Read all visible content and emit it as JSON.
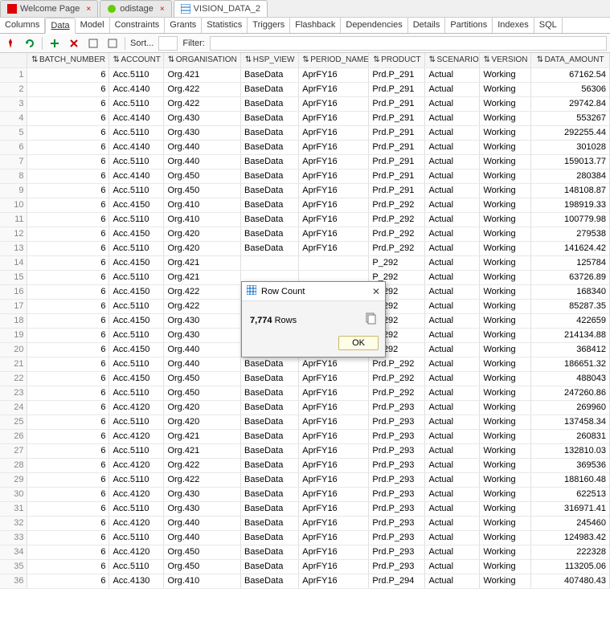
{
  "tabs": [
    {
      "label": "Welcome Page",
      "icon": "oracle-icon"
    },
    {
      "label": "odistage",
      "icon": "sql-icon"
    },
    {
      "label": "VISION_DATA_2",
      "icon": "table-icon",
      "active": true
    }
  ],
  "subtabs": [
    "Columns",
    "Data",
    "Model",
    "Constraints",
    "Grants",
    "Statistics",
    "Triggers",
    "Flashback",
    "Dependencies",
    "Details",
    "Partitions",
    "Indexes",
    "SQL"
  ],
  "active_subtab": "Data",
  "toolbar": {
    "sort_label": "Sort...",
    "sort_value": "",
    "filter_label": "Filter:",
    "filter_value": ""
  },
  "columns": [
    "BATCH_NUMBER",
    "ACCOUNT",
    "ORGANISATION",
    "HSP_VIEW",
    "PERIOD_NAME",
    "PRODUCT",
    "SCENARIO",
    "VERSION",
    "DATA_AMOUNT"
  ],
  "rows": [
    {
      "n": 1,
      "batch": 6,
      "acct": "Acc.5110",
      "org": "Org.421",
      "hsp": "BaseData",
      "per": "AprFY16",
      "prd": "Prd.P_291",
      "scen": "Actual",
      "ver": "Working",
      "amt": "67162.54"
    },
    {
      "n": 2,
      "batch": 6,
      "acct": "Acc.4140",
      "org": "Org.422",
      "hsp": "BaseData",
      "per": "AprFY16",
      "prd": "Prd.P_291",
      "scen": "Actual",
      "ver": "Working",
      "amt": "56306"
    },
    {
      "n": 3,
      "batch": 6,
      "acct": "Acc.5110",
      "org": "Org.422",
      "hsp": "BaseData",
      "per": "AprFY16",
      "prd": "Prd.P_291",
      "scen": "Actual",
      "ver": "Working",
      "amt": "29742.84"
    },
    {
      "n": 4,
      "batch": 6,
      "acct": "Acc.4140",
      "org": "Org.430",
      "hsp": "BaseData",
      "per": "AprFY16",
      "prd": "Prd.P_291",
      "scen": "Actual",
      "ver": "Working",
      "amt": "553267"
    },
    {
      "n": 5,
      "batch": 6,
      "acct": "Acc.5110",
      "org": "Org.430",
      "hsp": "BaseData",
      "per": "AprFY16",
      "prd": "Prd.P_291",
      "scen": "Actual",
      "ver": "Working",
      "amt": "292255.44"
    },
    {
      "n": 6,
      "batch": 6,
      "acct": "Acc.4140",
      "org": "Org.440",
      "hsp": "BaseData",
      "per": "AprFY16",
      "prd": "Prd.P_291",
      "scen": "Actual",
      "ver": "Working",
      "amt": "301028"
    },
    {
      "n": 7,
      "batch": 6,
      "acct": "Acc.5110",
      "org": "Org.440",
      "hsp": "BaseData",
      "per": "AprFY16",
      "prd": "Prd.P_291",
      "scen": "Actual",
      "ver": "Working",
      "amt": "159013.77"
    },
    {
      "n": 8,
      "batch": 6,
      "acct": "Acc.4140",
      "org": "Org.450",
      "hsp": "BaseData",
      "per": "AprFY16",
      "prd": "Prd.P_291",
      "scen": "Actual",
      "ver": "Working",
      "amt": "280384"
    },
    {
      "n": 9,
      "batch": 6,
      "acct": "Acc.5110",
      "org": "Org.450",
      "hsp": "BaseData",
      "per": "AprFY16",
      "prd": "Prd.P_291",
      "scen": "Actual",
      "ver": "Working",
      "amt": "148108.87"
    },
    {
      "n": 10,
      "batch": 6,
      "acct": "Acc.4150",
      "org": "Org.410",
      "hsp": "BaseData",
      "per": "AprFY16",
      "prd": "Prd.P_292",
      "scen": "Actual",
      "ver": "Working",
      "amt": "198919.33"
    },
    {
      "n": 11,
      "batch": 6,
      "acct": "Acc.5110",
      "org": "Org.410",
      "hsp": "BaseData",
      "per": "AprFY16",
      "prd": "Prd.P_292",
      "scen": "Actual",
      "ver": "Working",
      "amt": "100779.98"
    },
    {
      "n": 12,
      "batch": 6,
      "acct": "Acc.4150",
      "org": "Org.420",
      "hsp": "BaseData",
      "per": "AprFY16",
      "prd": "Prd.P_292",
      "scen": "Actual",
      "ver": "Working",
      "amt": "279538"
    },
    {
      "n": 13,
      "batch": 6,
      "acct": "Acc.5110",
      "org": "Org.420",
      "hsp": "BaseData",
      "per": "AprFY16",
      "prd": "Prd.P_292",
      "scen": "Actual",
      "ver": "Working",
      "amt": "141624.42"
    },
    {
      "n": 14,
      "batch": 6,
      "acct": "Acc.4150",
      "org": "Org.421",
      "hsp": "",
      "per": "",
      "prd": "P_292",
      "scen": "Actual",
      "ver": "Working",
      "amt": "125784"
    },
    {
      "n": 15,
      "batch": 6,
      "acct": "Acc.5110",
      "org": "Org.421",
      "hsp": "",
      "per": "",
      "prd": "P_292",
      "scen": "Actual",
      "ver": "Working",
      "amt": "63726.89"
    },
    {
      "n": 16,
      "batch": 6,
      "acct": "Acc.4150",
      "org": "Org.422",
      "hsp": "",
      "per": "",
      "prd": "P_292",
      "scen": "Actual",
      "ver": "Working",
      "amt": "168340"
    },
    {
      "n": 17,
      "batch": 6,
      "acct": "Acc.5110",
      "org": "Org.422",
      "hsp": "",
      "per": "",
      "prd": "P_292",
      "scen": "Actual",
      "ver": "Working",
      "amt": "85287.35"
    },
    {
      "n": 18,
      "batch": 6,
      "acct": "Acc.4150",
      "org": "Org.430",
      "hsp": "",
      "per": "",
      "prd": "P_292",
      "scen": "Actual",
      "ver": "Working",
      "amt": "422659"
    },
    {
      "n": 19,
      "batch": 6,
      "acct": "Acc.5110",
      "org": "Org.430",
      "hsp": "",
      "per": "",
      "prd": "P_292",
      "scen": "Actual",
      "ver": "Working",
      "amt": "214134.88"
    },
    {
      "n": 20,
      "batch": 6,
      "acct": "Acc.4150",
      "org": "Org.440",
      "hsp": "",
      "per": "",
      "prd": "P_292",
      "scen": "Actual",
      "ver": "Working",
      "amt": "368412"
    },
    {
      "n": 21,
      "batch": 6,
      "acct": "Acc.5110",
      "org": "Org.440",
      "hsp": "BaseData",
      "per": "AprFY16",
      "prd": "Prd.P_292",
      "scen": "Actual",
      "ver": "Working",
      "amt": "186651.32"
    },
    {
      "n": 22,
      "batch": 6,
      "acct": "Acc.4150",
      "org": "Org.450",
      "hsp": "BaseData",
      "per": "AprFY16",
      "prd": "Prd.P_292",
      "scen": "Actual",
      "ver": "Working",
      "amt": "488043"
    },
    {
      "n": 23,
      "batch": 6,
      "acct": "Acc.5110",
      "org": "Org.450",
      "hsp": "BaseData",
      "per": "AprFY16",
      "prd": "Prd.P_292",
      "scen": "Actual",
      "ver": "Working",
      "amt": "247260.86"
    },
    {
      "n": 24,
      "batch": 6,
      "acct": "Acc.4120",
      "org": "Org.420",
      "hsp": "BaseData",
      "per": "AprFY16",
      "prd": "Prd.P_293",
      "scen": "Actual",
      "ver": "Working",
      "amt": "269960"
    },
    {
      "n": 25,
      "batch": 6,
      "acct": "Acc.5110",
      "org": "Org.420",
      "hsp": "BaseData",
      "per": "AprFY16",
      "prd": "Prd.P_293",
      "scen": "Actual",
      "ver": "Working",
      "amt": "137458.34"
    },
    {
      "n": 26,
      "batch": 6,
      "acct": "Acc.4120",
      "org": "Org.421",
      "hsp": "BaseData",
      "per": "AprFY16",
      "prd": "Prd.P_293",
      "scen": "Actual",
      "ver": "Working",
      "amt": "260831"
    },
    {
      "n": 27,
      "batch": 6,
      "acct": "Acc.5110",
      "org": "Org.421",
      "hsp": "BaseData",
      "per": "AprFY16",
      "prd": "Prd.P_293",
      "scen": "Actual",
      "ver": "Working",
      "amt": "132810.03"
    },
    {
      "n": 28,
      "batch": 6,
      "acct": "Acc.4120",
      "org": "Org.422",
      "hsp": "BaseData",
      "per": "AprFY16",
      "prd": "Prd.P_293",
      "scen": "Actual",
      "ver": "Working",
      "amt": "369536"
    },
    {
      "n": 29,
      "batch": 6,
      "acct": "Acc.5110",
      "org": "Org.422",
      "hsp": "BaseData",
      "per": "AprFY16",
      "prd": "Prd.P_293",
      "scen": "Actual",
      "ver": "Working",
      "amt": "188160.48"
    },
    {
      "n": 30,
      "batch": 6,
      "acct": "Acc.4120",
      "org": "Org.430",
      "hsp": "BaseData",
      "per": "AprFY16",
      "prd": "Prd.P_293",
      "scen": "Actual",
      "ver": "Working",
      "amt": "622513"
    },
    {
      "n": 31,
      "batch": 6,
      "acct": "Acc.5110",
      "org": "Org.430",
      "hsp": "BaseData",
      "per": "AprFY16",
      "prd": "Prd.P_293",
      "scen": "Actual",
      "ver": "Working",
      "amt": "316971.41"
    },
    {
      "n": 32,
      "batch": 6,
      "acct": "Acc.4120",
      "org": "Org.440",
      "hsp": "BaseData",
      "per": "AprFY16",
      "prd": "Prd.P_293",
      "scen": "Actual",
      "ver": "Working",
      "amt": "245460"
    },
    {
      "n": 33,
      "batch": 6,
      "acct": "Acc.5110",
      "org": "Org.440",
      "hsp": "BaseData",
      "per": "AprFY16",
      "prd": "Prd.P_293",
      "scen": "Actual",
      "ver": "Working",
      "amt": "124983.42"
    },
    {
      "n": 34,
      "batch": 6,
      "acct": "Acc.4120",
      "org": "Org.450",
      "hsp": "BaseData",
      "per": "AprFY16",
      "prd": "Prd.P_293",
      "scen": "Actual",
      "ver": "Working",
      "amt": "222328"
    },
    {
      "n": 35,
      "batch": 6,
      "acct": "Acc.5110",
      "org": "Org.450",
      "hsp": "BaseData",
      "per": "AprFY16",
      "prd": "Prd.P_293",
      "scen": "Actual",
      "ver": "Working",
      "amt": "113205.06"
    },
    {
      "n": 36,
      "batch": 6,
      "acct": "Acc.4130",
      "org": "Org.410",
      "hsp": "BaseData",
      "per": "AprFY16",
      "prd": "Prd.P_294",
      "scen": "Actual",
      "ver": "Working",
      "amt": "407480.43"
    }
  ],
  "dialog": {
    "title": "Row Count",
    "count_text": "7,774",
    "rows_label": "Rows",
    "ok_label": "OK"
  }
}
